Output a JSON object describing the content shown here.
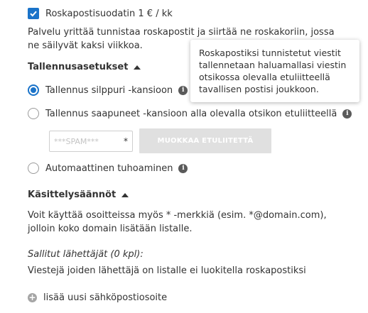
{
  "filter": {
    "checked": true,
    "label": "Roskapostisuodatin 1 € / kk",
    "description_line1": "Palvelu yrittää tunnistaa roskapostit ja siirtää ne roskakoriin, jossa",
    "description_line2": "ne säilyvät kaksi viikkoa."
  },
  "storage": {
    "heading": "Tallennusasetukset",
    "options": [
      {
        "label": "Tallennus silppuri -kansioon",
        "selected": true
      },
      {
        "label": "Tallennus saapuneet -kansioon alla olevalla otsikon etuliitteellä",
        "selected": false
      },
      {
        "label": "Automaattinen tuhoaminen",
        "selected": false
      }
    ],
    "prefix_placeholder": "***SPAM***",
    "prefix_asterisk": "*",
    "edit_prefix_button": "MUOKKAA ETULIITETTÄ"
  },
  "tooltip": {
    "line1": "Roskapostiksi tunnistetut viestit",
    "line2": "tallennetaan haluamallasi viestin",
    "line3": "otsikossa olevalla etuliitteellä",
    "line4": "tavallisen postisi joukkoon."
  },
  "rules": {
    "heading": "Käsittelysäännöt",
    "description_line1": "Voit käyttää osoitteissa myös * -merkkiä (esim. *@domain.com),",
    "description_line2": "jolloin koko domain lisätään listalle.",
    "allowed_title": "Sallitut lähettäjät (0 kpl):",
    "allowed_description": "Viestejä joiden lähettäjä on listalle ei luokitella roskapostiksi",
    "add_address_label": "lisää uusi sähköpostiosoite"
  },
  "colors": {
    "accent": "#1a73c9",
    "text": "#333333",
    "disabled_button": "#e0e0e0"
  }
}
